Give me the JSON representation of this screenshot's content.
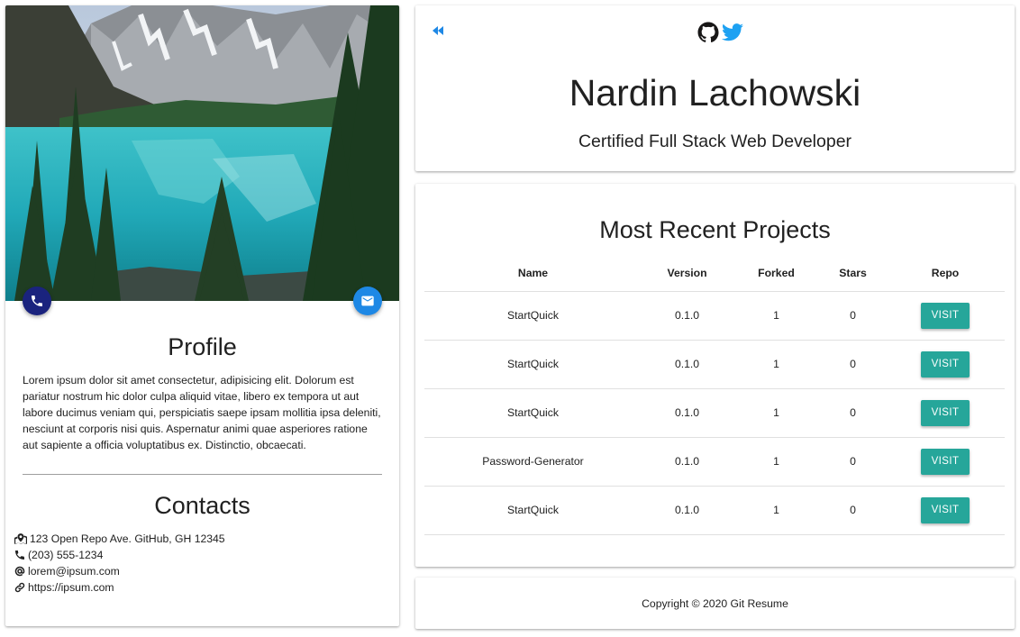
{
  "profile": {
    "title": "Profile",
    "bio": "Lorem ipsum dolor sit amet consectetur, adipisicing elit. Dolorum est pariatur nostrum hic dolor culpa aliquid vitae, libero ex tempora ut aut labore ducimus veniam qui, perspiciatis saepe ipsam mollitia ipsa deleniti, nesciunt at corporis nisi quis. Aspernatur animi quae asperiores ratione aut sapiente a officia voluptatibus ex. Distinctio, obcaecati.",
    "phone_fab_icon": "phone-icon",
    "email_fab_icon": "email-icon"
  },
  "contacts": {
    "title": "Contacts",
    "items": [
      {
        "icon": "map-icon",
        "text": "123 Open Repo Ave. GitHub, GH 12345"
      },
      {
        "icon": "phone-icon",
        "text": "(203) 555-1234"
      },
      {
        "icon": "at-icon",
        "text": "lorem@ipsum.com"
      },
      {
        "icon": "link-icon",
        "text": "https://ipsum.com"
      }
    ]
  },
  "header": {
    "name": "Nardin Lachowski",
    "subtitle": "Certified Full Stack Web Developer",
    "icons": [
      "back-icon",
      "github-icon",
      "twitter-icon"
    ]
  },
  "projects": {
    "title": "Most Recent Projects",
    "columns": [
      "Name",
      "Version",
      "Forked",
      "Stars",
      "Repo"
    ],
    "rows": [
      {
        "name": "StartQuick",
        "version": "0.1.0",
        "forked": "1",
        "stars": "0",
        "repo_label": "VISIT"
      },
      {
        "name": "StartQuick",
        "version": "0.1.0",
        "forked": "1",
        "stars": "0",
        "repo_label": "VISIT"
      },
      {
        "name": "StartQuick",
        "version": "0.1.0",
        "forked": "1",
        "stars": "0",
        "repo_label": "VISIT"
      },
      {
        "name": "Password-Generator",
        "version": "0.1.0",
        "forked": "1",
        "stars": "0",
        "repo_label": "VISIT"
      },
      {
        "name": "StartQuick",
        "version": "0.1.0",
        "forked": "1",
        "stars": "0",
        "repo_label": "VISIT"
      }
    ]
  },
  "footer": {
    "copyright": "Copyright © 2020 Git Resume"
  },
  "colors": {
    "accent_teal": "#26a69a",
    "phone_fab": "#1a237e",
    "email_fab": "#1e88e5",
    "back_icon": "#1e88e5",
    "twitter": "#1da1f2"
  }
}
